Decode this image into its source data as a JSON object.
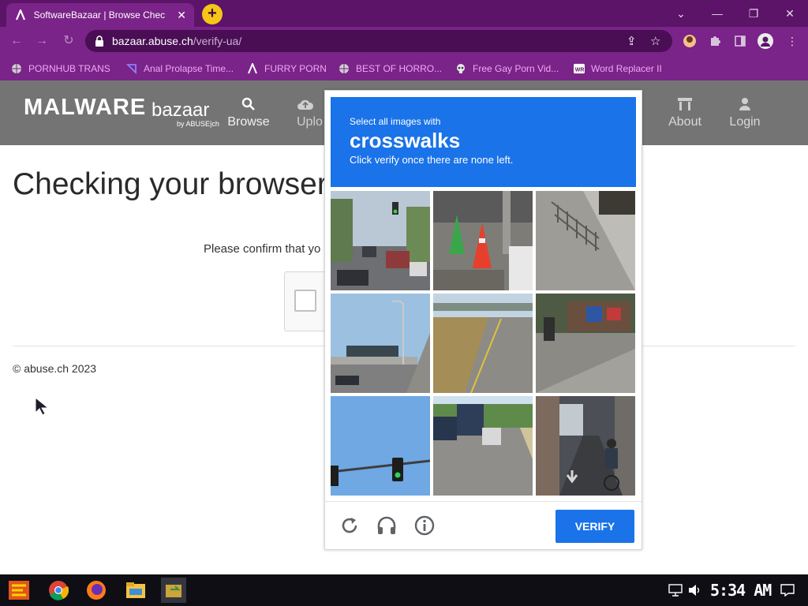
{
  "browser": {
    "tab": {
      "title": "SoftwareBazaar | Browse Chec"
    },
    "url": {
      "host": "bazaar.abuse.ch",
      "path": "/verify-ua/"
    },
    "window_controls": [
      "⌄",
      "—",
      "❐",
      "✕"
    ]
  },
  "bookmarks": [
    {
      "label": "PORNHUB TRANS",
      "icon": "globe-icon"
    },
    {
      "label": "Anal Prolapse Time...",
      "icon": "triangle-icon"
    },
    {
      "label": "FURRY PORN",
      "icon": "lambda-icon"
    },
    {
      "label": "BEST OF HORRO...",
      "icon": "globe-icon"
    },
    {
      "label": "Free Gay Porn Vid...",
      "icon": "skull-icon"
    },
    {
      "label": "Word Replacer II",
      "icon": "wr-icon"
    }
  ],
  "site": {
    "logo_main": "MALWARE",
    "logo_sub": "bazaar",
    "logo_by": "by ABUSE|ch",
    "nav": [
      {
        "label": "Browse",
        "icon": "search-icon"
      },
      {
        "label": "Uplo",
        "icon": "cloud-upload-icon"
      },
      {
        "label": "About",
        "icon": "building-icon"
      },
      {
        "label": "Login",
        "icon": "user-icon"
      }
    ],
    "title": "Checking your browser",
    "confirm_text": "Please confirm that yo",
    "footer": "© abuse.ch 2023"
  },
  "captcha": {
    "prompt_small": "Select all images with",
    "prompt_big": "crosswalks",
    "prompt_note": "Click verify once there are none left.",
    "tiles": [
      "traffic-light-street",
      "traffic-cones",
      "sidewalk-railing",
      "highway-overpass",
      "road-with-grass",
      "street-market",
      "traffic-light-sky",
      "road-with-bus",
      "alley-with-cyclist"
    ],
    "verify_label": "VERIFY"
  },
  "taskbar": {
    "clock": "5:34 AM"
  },
  "colors": {
    "chrome_dark": "#5b1467",
    "chrome": "#7a2388",
    "captcha_blue": "#1a73e8",
    "header_gray": "#747474"
  }
}
